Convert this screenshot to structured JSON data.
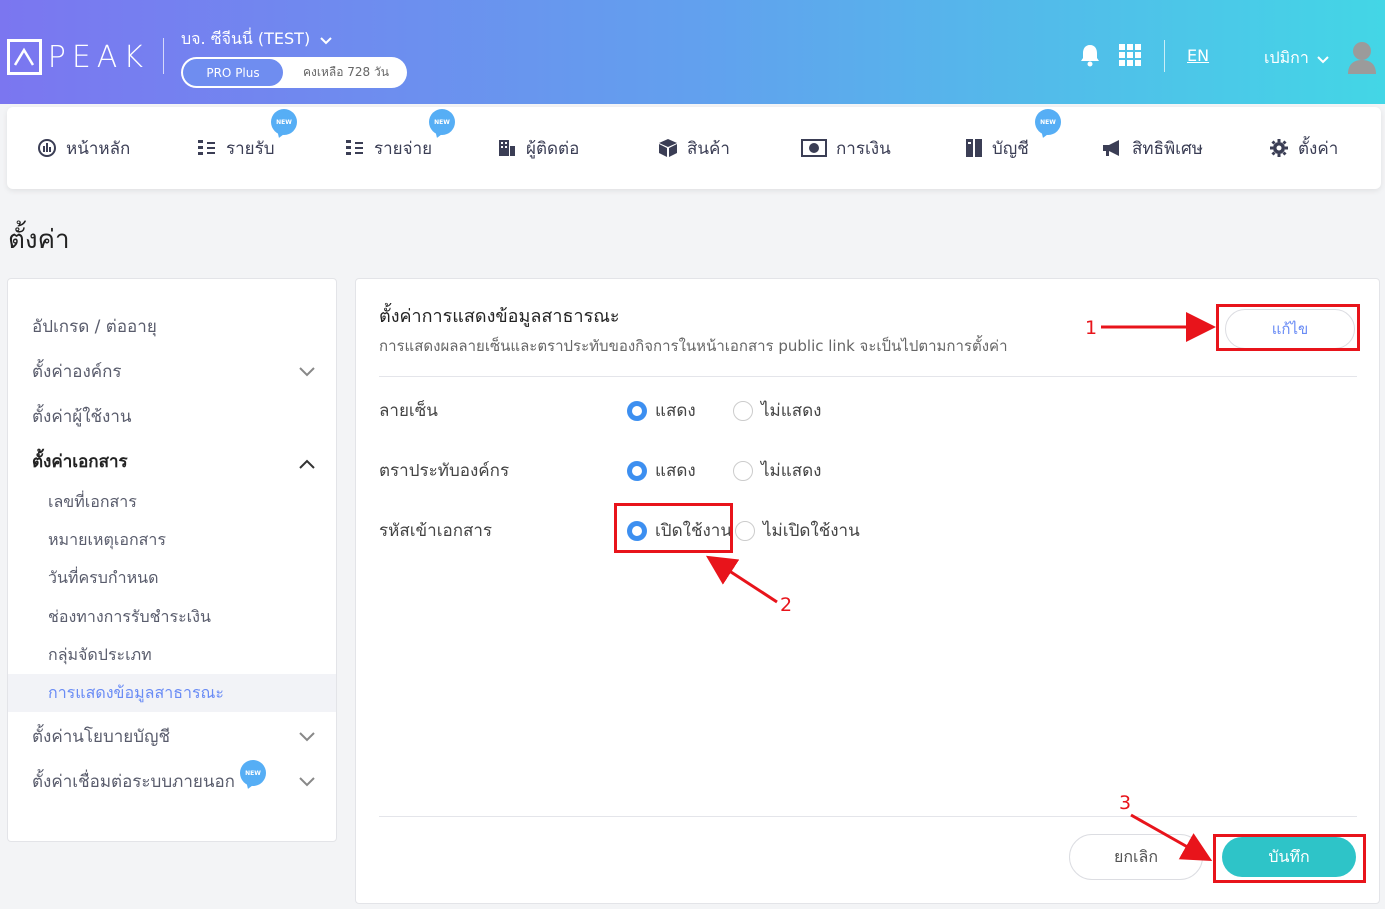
{
  "header": {
    "logo_text": "PEAK",
    "company": "บจ. ซีจีนนี่ (TEST)",
    "plan": "PRO Plus",
    "remaining": "คงเหลือ 728 วัน",
    "language": "EN",
    "user_name": "เปมิกา",
    "icons": [
      "bell-icon",
      "apps-grid-icon",
      "avatar-icon"
    ]
  },
  "nav": {
    "items": [
      {
        "label": "หน้าหลัก",
        "icon": "dashboard-icon",
        "new": false
      },
      {
        "label": "รายรับ",
        "icon": "income-icon",
        "new": true
      },
      {
        "label": "รายจ่าย",
        "icon": "expense-icon",
        "new": true
      },
      {
        "label": "ผู้ติดต่อ",
        "icon": "contacts-icon",
        "new": false
      },
      {
        "label": "สินค้า",
        "icon": "product-icon",
        "new": false
      },
      {
        "label": "การเงิน",
        "icon": "money-icon",
        "new": false
      },
      {
        "label": "บัญชี",
        "icon": "accounting-icon",
        "new": true
      },
      {
        "label": "สิทธิพิเศษ",
        "icon": "megaphone-icon",
        "new": false
      },
      {
        "label": "ตั้งค่า",
        "icon": "gear-icon",
        "new": false
      }
    ],
    "new_badge": "NEW"
  },
  "page": {
    "title": "ตั้งค่า"
  },
  "sidebar": {
    "items": [
      {
        "label": "อัปเกรด / ต่ออายุ"
      },
      {
        "label": "ตั้งค่าองค์กร"
      },
      {
        "label": "ตั้งค่าผู้ใช้งาน"
      },
      {
        "label": "ตั้งค่าเอกสาร"
      },
      {
        "label": "ตั้งค่านโยบายบัญชี"
      },
      {
        "label": "ตั้งค่าเชื่อมต่อระบบภายนอก"
      }
    ],
    "sub_items": [
      {
        "label": "เลขที่เอกสาร"
      },
      {
        "label": "หมายเหตุเอกสาร"
      },
      {
        "label": "วันที่ครบกำหนด"
      },
      {
        "label": "ช่องทางการรับชำระเงิน"
      },
      {
        "label": "กลุ่มจัดประเภท"
      },
      {
        "label": "การแสดงข้อมูลสาธารณะ"
      }
    ]
  },
  "panel": {
    "title": "ตั้งค่าการแสดงข้อมูลสาธารณะ",
    "description": "การแสดงผลลายเซ็นและตราประทับของกิจการในหน้าเอกสาร public link จะเป็นไปตามการตั้งค่า",
    "edit_label": "แก้ไข",
    "rows": [
      {
        "label": "ลายเซ็น",
        "option_on": "แสดง",
        "option_off": "ไม่แสดง",
        "selected": "on"
      },
      {
        "label": "ตราประทับองค์กร",
        "option_on": "แสดง",
        "option_off": "ไม่แสดง",
        "selected": "on"
      },
      {
        "label": "รหัสเข้าเอกสาร",
        "option_on": "เปิดใช้งาน",
        "option_off": "ไม่เปิดใช้งาน",
        "selected": "on"
      }
    ],
    "cancel_label": "ยกเลิก",
    "save_label": "บันทึก"
  },
  "annotations": {
    "step1": "1",
    "step2": "2",
    "step3": "3",
    "color": "#e8141b"
  },
  "colors": {
    "header_gradient_start": "#7b76f0",
    "header_gradient_end": "#43d6e6",
    "accent_blue": "#6a8cf5",
    "radio_blue": "#3d8ff0",
    "save_teal": "#2ec4c8"
  }
}
